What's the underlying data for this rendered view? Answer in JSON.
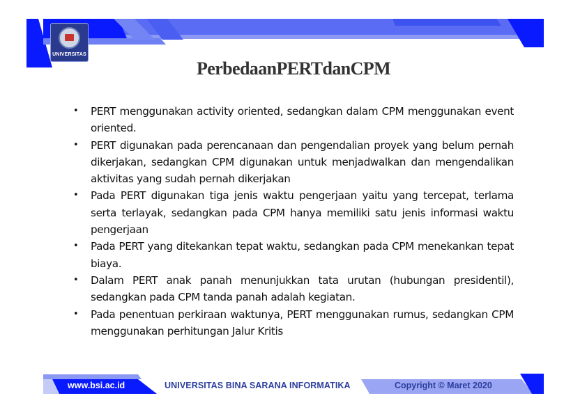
{
  "header": {
    "logo_label": "UNIVERSITAS",
    "brand_colors": {
      "deep_blue": "#0a1aff",
      "mid_blue": "#5468f5",
      "light_blue": "#8c99f2",
      "logo_bg": "#2a3a8c"
    }
  },
  "slide": {
    "title": "PerbedaanPERTdanCPM",
    "bullets": [
      "PERT menggunakan activity oriented, sedangkan dalam CPM menggunakan event oriented.",
      "PERT digunakan pada perencanaan dan pengendalian proyek yang belum pernah dikerjakan, sedangkan CPM digunakan untuk menjadwalkan dan mengendalikan aktivitas yang sudah pernah dikerjakan",
      "Pada PERT digunakan tiga jenis waktu pengerjaan yaitu yang tercepat, terlama serta terlayak, sedangkan pada CPM hanya memiliki satu jenis informasi waktu pengerjaan",
      "Pada PERT yang ditekankan tepat waktu, sedangkan pada CPM menekankan tepat biaya.",
      "Dalam PERT anak panah menunjukkan tata urutan (hubungan presidentil), sedangkan pada CPM tanda panah adalah kegiatan.",
      "Pada penentuan perkiraan waktunya, PERT menggunakan rumus, sedangkan CPM menggunakan perhitungan Jalur Kritis"
    ],
    "bullet_glyph": "•"
  },
  "footer": {
    "url": "www.bsi.ac.id",
    "university": "UNIVERSITAS BINA SARANA INFORMATIKA",
    "copyright": "Copyright © Maret 2020"
  }
}
